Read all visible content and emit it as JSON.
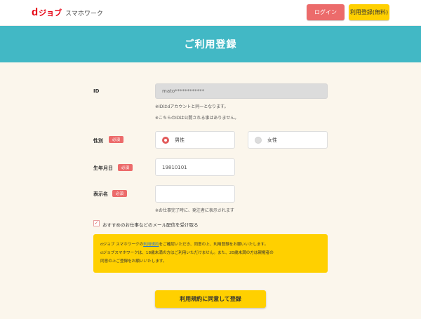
{
  "header": {
    "logo_d": "d",
    "logo_job": "ジョブ",
    "logo_sub": "スマホワーク",
    "login_label": "ログイン",
    "register_label": "利用登録(無料)"
  },
  "banner": {
    "title": "ご利用登録"
  },
  "required_badge": "必須",
  "form": {
    "id": {
      "label": "ID",
      "value": "mato************",
      "note1": "※IDはdアカウントと同一となります。",
      "note2": "※こちらのIDは公開される事はありません。"
    },
    "gender": {
      "label": "性別",
      "options": [
        {
          "label": "男性",
          "selected": true
        },
        {
          "label": "女性",
          "selected": false
        }
      ]
    },
    "birthdate": {
      "label": "生年月日",
      "value": "19810101"
    },
    "display_name": {
      "label": "表示名",
      "value": "",
      "note": "※お仕事完了時に、発注者に表示されます"
    },
    "newsletter": {
      "checked": true,
      "label": "おすすめのお仕事などのメール配信を受け取る"
    }
  },
  "notice": {
    "line1_prefix": "dジョブ スマホワークの",
    "line1_link": "利用規約",
    "line1_suffix": "をご確認いただき、同意の上、利用登録をお願いいたします。",
    "line2": "dジョブスマホワークは、18歳未満の方はご利用いただけません。また、20歳未満の方は親権者の",
    "line3": "同意の上ご登録をお願いいたします。"
  },
  "submit_label": "利用規約に同意して登録",
  "colors": {
    "brand_red": "#e60012",
    "teal": "#42b8c5",
    "yellow": "#ffd000",
    "pink": "#ec6b6b",
    "background": "#fbf6ec"
  }
}
